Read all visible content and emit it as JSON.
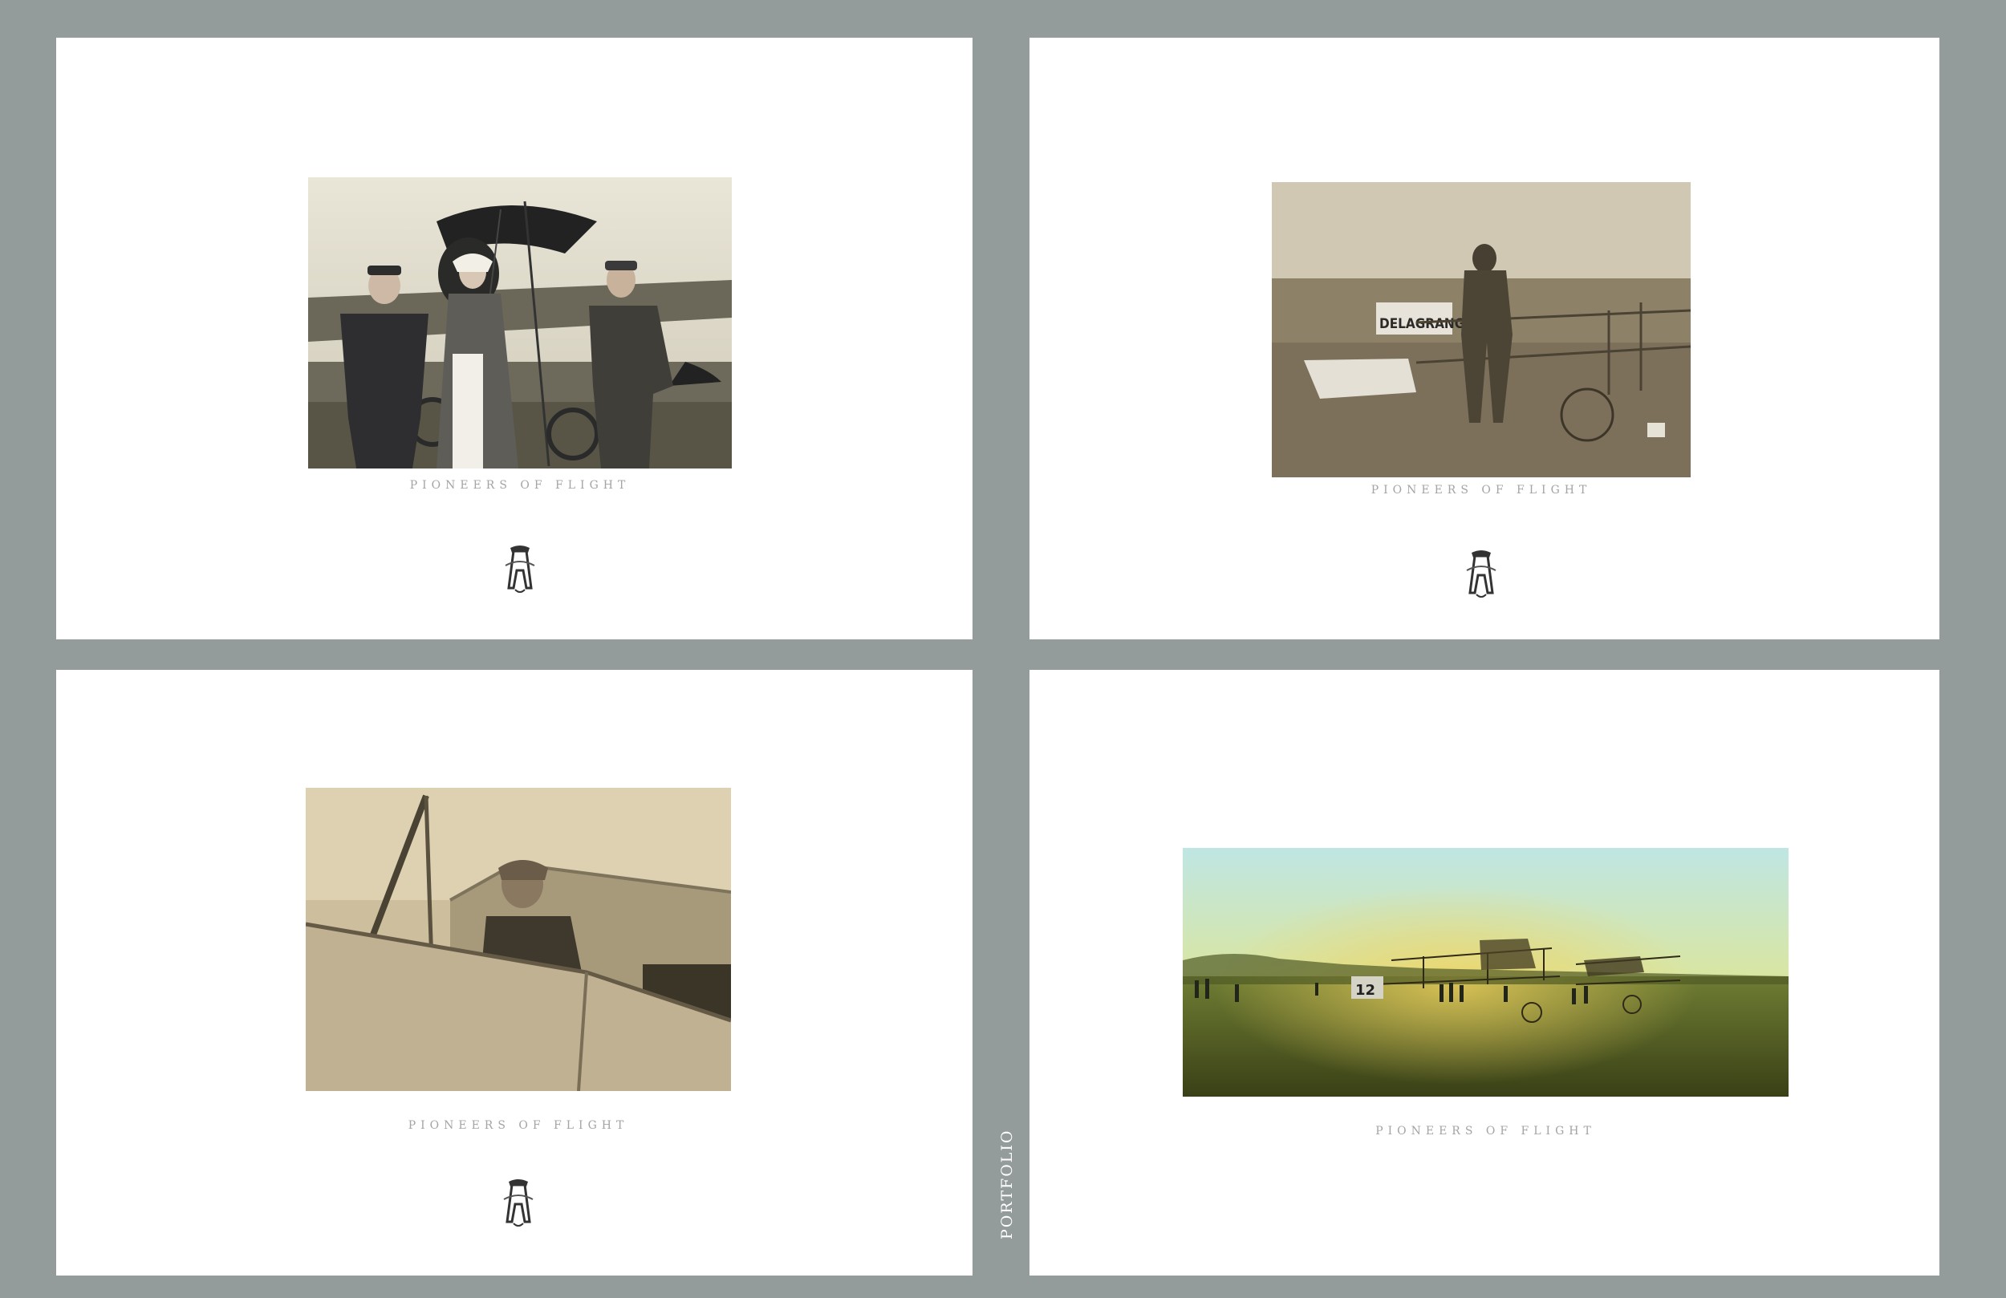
{
  "sidebar": {
    "spine_label": "PORTFOLIO"
  },
  "colors": {
    "frame": "#939c9a",
    "page": "#ffffff",
    "caption": "#a4a4a4"
  },
  "pages": [
    {
      "caption": "PIONEERS OF FLIGHT",
      "photo": "sepia-photo-two-men-woman-monoplane",
      "monogram": "monogram-icon"
    },
    {
      "caption": "PIONEERS OF FLIGHT",
      "photo": "sepia-photo-aviator-delagrange-plane",
      "monogram": "monogram-icon",
      "plane_lettering": "DELAGRANGE"
    },
    {
      "caption": "PIONEERS OF FLIGHT",
      "photo": "sepia-photo-aviator-in-cockpit",
      "monogram": "monogram-icon"
    },
    {
      "caption": "PIONEERS OF FLIGHT",
      "photo": "color-photo-biplanes-airfield-sunset",
      "plane_number": "12"
    }
  ]
}
